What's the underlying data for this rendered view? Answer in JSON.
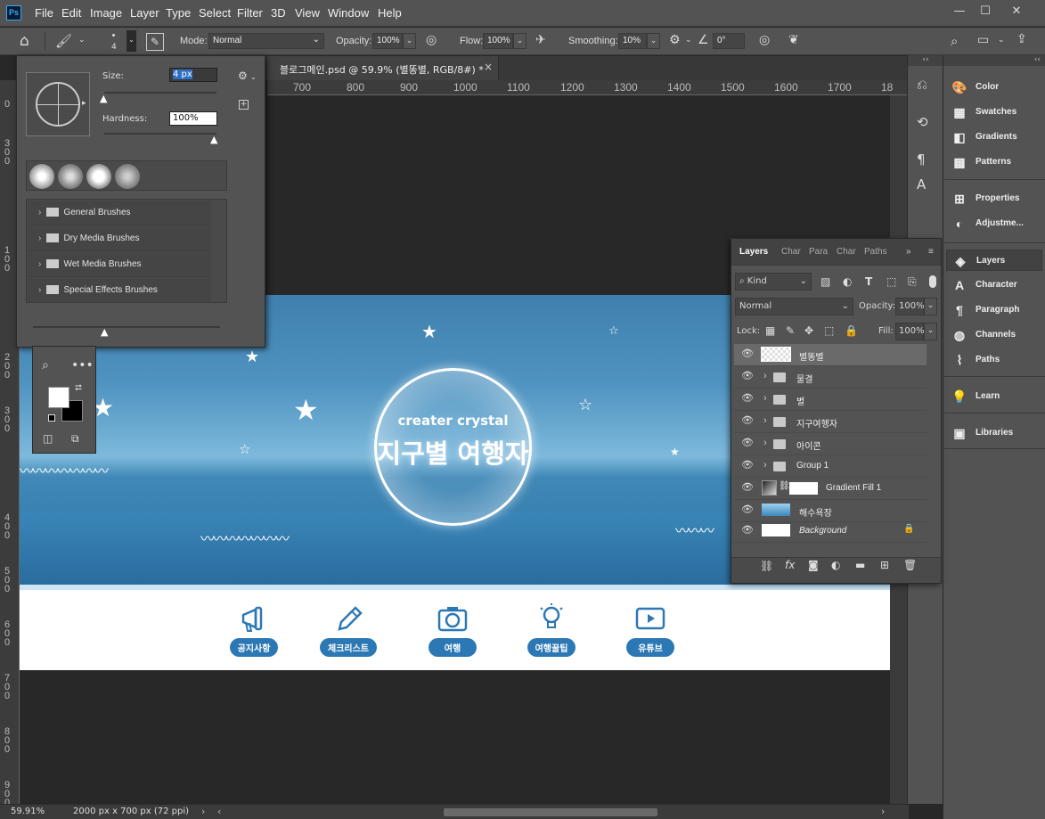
{
  "app": {
    "logo": "Ps",
    "menu": [
      "File",
      "Edit",
      "Image",
      "Layer",
      "Type",
      "Select",
      "Filter",
      "3D",
      "View",
      "Window",
      "Help"
    ]
  },
  "options": {
    "brush_size": "4",
    "mode_label": "Mode:",
    "mode_value": "Normal",
    "opacity_label": "Opacity:",
    "opacity_value": "100%",
    "flow_label": "Flow:",
    "flow_value": "100%",
    "smoothing_label": "Smoothing:",
    "smoothing_value": "10%",
    "angle_value": "0°"
  },
  "doc_tab": {
    "title": "블로그메인.psd @ 59.9% (별똥별, RGB/8#) *",
    "close": "×"
  },
  "ruler_top": [
    "700",
    "800",
    "900",
    "1000",
    "1100",
    "1200",
    "1300",
    "1400",
    "1500",
    "1600",
    "1700",
    "18"
  ],
  "ruler_left": [
    "0",
    "3 0 0",
    "1 0 0",
    "2 0 0",
    "3 0 0",
    "4 0 0",
    "5 0 0",
    "6 0 0",
    "7 0 0",
    "8 0 0",
    "9 0 0"
  ],
  "brush_panel": {
    "size_label": "Size:",
    "size_value": "4 px",
    "hardness_label": "Hardness:",
    "hardness_value": "100%",
    "folders": [
      "General Brushes",
      "Dry Media Brushes",
      "Wet Media Brushes",
      "Special Effects Brushes"
    ]
  },
  "banner": {
    "subtitle": "creater crystal",
    "title": "지구별 여행자"
  },
  "nav": [
    {
      "label": "공지사항",
      "icon": "megaphone-icon"
    },
    {
      "label": "체크리스트",
      "icon": "pencil-icon"
    },
    {
      "label": "여행",
      "icon": "camera-icon"
    },
    {
      "label": "여행꿀팁",
      "icon": "lightbulb-icon"
    },
    {
      "label": "유튜브",
      "icon": "youtube-icon"
    }
  ],
  "status": {
    "zoom": "59.91%",
    "doc_info": "2000 px x 700 px (72 ppi)"
  },
  "dock": [
    {
      "label": "Color",
      "icon": "palette-icon"
    },
    {
      "label": "Swatches",
      "icon": "grid-icon"
    },
    {
      "label": "Gradients",
      "icon": "gradient-icon"
    },
    {
      "label": "Patterns",
      "icon": "pattern-icon"
    },
    {
      "label": "Properties",
      "icon": "properties-icon"
    },
    {
      "label": "Adjustme...",
      "icon": "adjustments-icon"
    },
    {
      "label": "Layers",
      "icon": "layers-icon"
    },
    {
      "label": "Character",
      "icon": "character-icon"
    },
    {
      "label": "Paragraph",
      "icon": "paragraph-icon"
    },
    {
      "label": "Channels",
      "icon": "channels-icon"
    },
    {
      "label": "Paths",
      "icon": "paths-icon"
    },
    {
      "label": "Learn",
      "icon": "learn-icon"
    },
    {
      "label": "Libraries",
      "icon": "libraries-icon"
    }
  ],
  "layers_panel": {
    "tabs": [
      "Layers",
      "Char",
      "Para",
      "Char",
      "Paths"
    ],
    "kind_label": "Kind",
    "blend_mode": "Normal",
    "opacity_label": "Opacity:",
    "opacity_value": "100%",
    "lock_label": "Lock:",
    "fill_label": "Fill:",
    "fill_value": "100%",
    "layers": [
      {
        "name": "별똥별",
        "type": "pixel",
        "selected": true
      },
      {
        "name": "물결",
        "type": "group"
      },
      {
        "name": "별",
        "type": "group"
      },
      {
        "name": "지구여행자",
        "type": "group"
      },
      {
        "name": "아이콘",
        "type": "group"
      },
      {
        "name": "Group 1",
        "type": "group"
      },
      {
        "name": "Gradient Fill 1",
        "type": "fill"
      },
      {
        "name": "해수욕장",
        "type": "image"
      },
      {
        "name": "Background",
        "type": "background"
      }
    ]
  },
  "colors": {
    "accent": "#2c78b4",
    "panel": "#535353",
    "dark": "#282828"
  }
}
